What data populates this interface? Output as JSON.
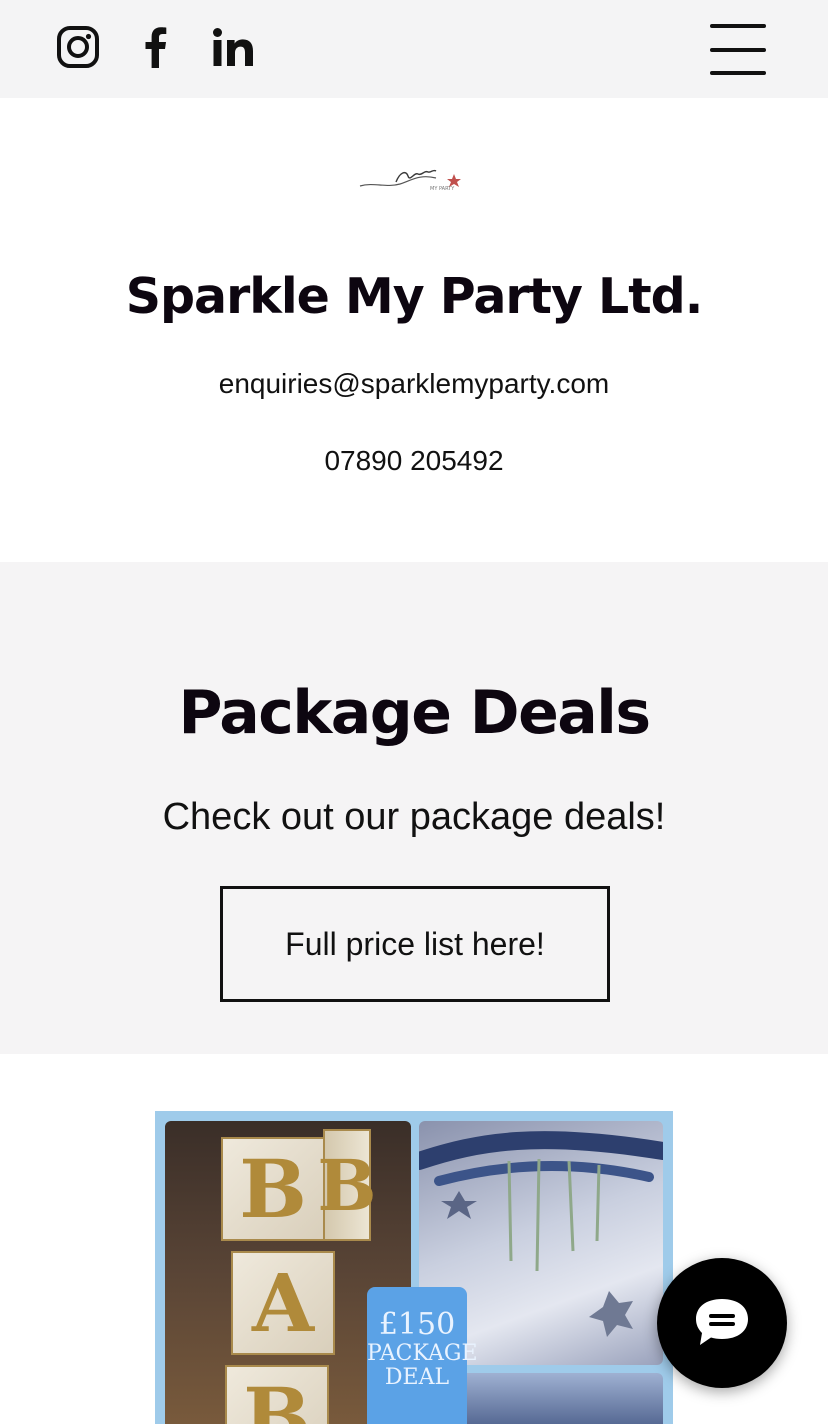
{
  "topbar": {
    "social": [
      {
        "name": "instagram-icon"
      },
      {
        "name": "facebook-icon"
      },
      {
        "name": "linkedin-icon"
      }
    ],
    "menu_icon": "hamburger-menu-icon"
  },
  "header": {
    "logo_text": "sparkle my party",
    "company_name": "Sparkle My Party Ltd.",
    "email": "enquiries@sparklemyparty.com",
    "phone": "07890 205492"
  },
  "deals": {
    "title": "Package Deals",
    "subtitle": "Check out our package deals!",
    "button_label": "Full price list here!"
  },
  "gallery": {
    "block_letters": [
      "B",
      "B",
      "A",
      "B"
    ],
    "price_tag": {
      "amount": "£150",
      "line1": "PACKAGE",
      "line2": "DEAL"
    }
  },
  "chat": {
    "icon": "chat-bubble-icon"
  },
  "colors": {
    "topbar_bg": "#f4f4f5",
    "deals_bg": "#f5f4f5",
    "heading": "#0d0610",
    "price_tag": "#5ba2e6"
  }
}
